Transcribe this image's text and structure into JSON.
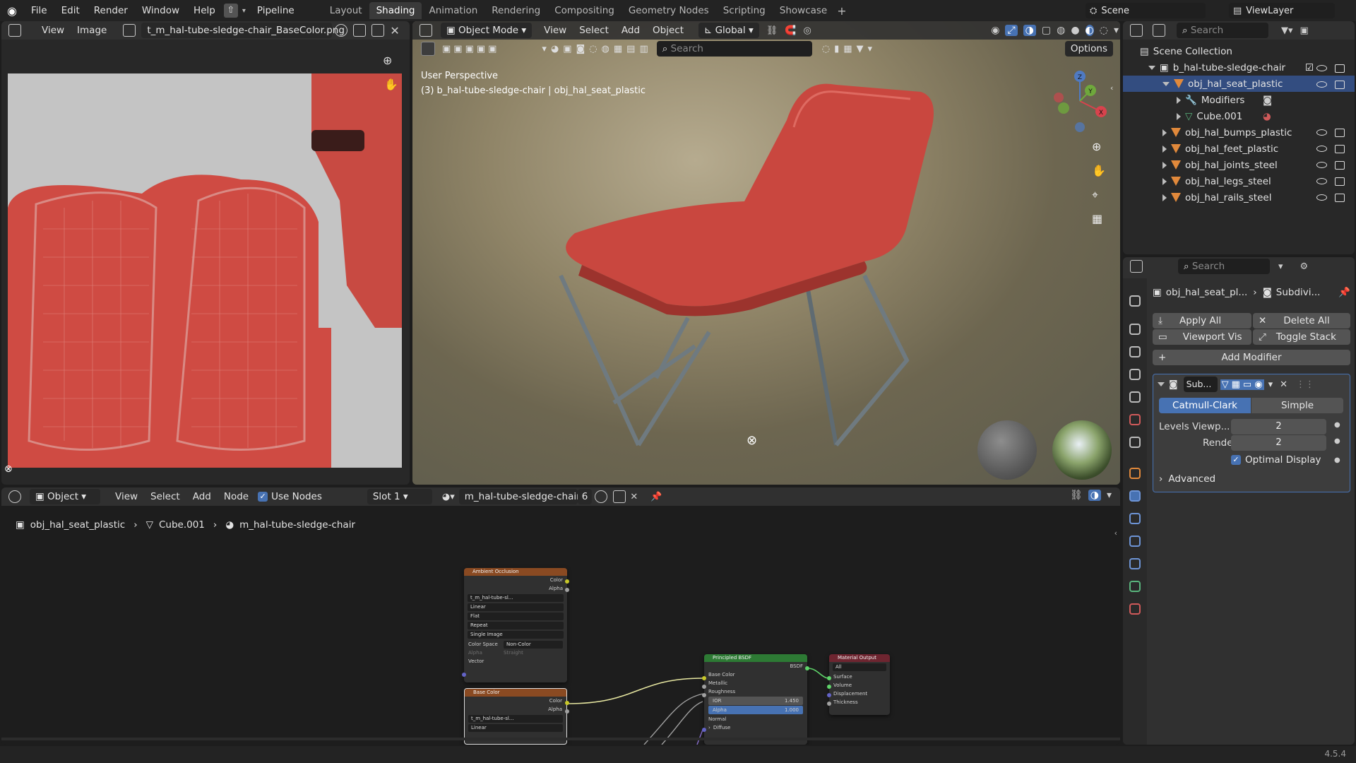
{
  "topbar": {
    "menus": [
      "File",
      "Edit",
      "Render",
      "Window",
      "Help"
    ],
    "pipeline": "Pipeline",
    "workspaces": [
      "Layout",
      "Shading",
      "Animation",
      "Rendering",
      "Compositing",
      "Geometry Nodes",
      "Scripting",
      "Showcase"
    ],
    "active_workspace": "Shading",
    "scene": "Scene",
    "view_layer": "ViewLayer"
  },
  "image_editor": {
    "menus": [
      "View",
      "Image"
    ],
    "image_name": "t_m_hal-tube-sledge-chair_BaseColor.png"
  },
  "viewport": {
    "mode": "Object Mode",
    "menus": [
      "View",
      "Select",
      "Add",
      "Object"
    ],
    "orientation": "Global",
    "search_placeholder": "Search",
    "options": "Options",
    "perspective_label": "User Perspective",
    "object_label": "(3) b_hal-tube-sledge-chair | obj_hal_seat_plastic",
    "axes": {
      "x": "X",
      "y": "Y",
      "z": "Z"
    }
  },
  "outliner": {
    "search_placeholder": "Search",
    "root": "Scene Collection",
    "collection": "b_hal-tube-sledge-chair",
    "active_object": "obj_hal_seat_plastic",
    "modifiers": "Modifiers",
    "mesh": "Cube.001",
    "objects": [
      "obj_hal_bumps_plastic",
      "obj_hal_feet_plastic",
      "obj_hal_joints_steel",
      "obj_hal_legs_steel",
      "obj_hal_rails_steel"
    ]
  },
  "properties": {
    "search_placeholder": "Search",
    "object_name": "obj_hal_seat_pl...",
    "modifier_crumb": "Subdivi...",
    "apply_all": "Apply All",
    "delete_all": "Delete All",
    "viewport_vis": "Viewport Vis",
    "toggle_stack": "Toggle Stack",
    "add_modifier": "Add Modifier",
    "modifier_name": "Sub...",
    "catmull": "Catmull-Clark",
    "simple": "Simple",
    "levels_label": "Levels Viewp...",
    "levels_value": "2",
    "render_label": "Render",
    "render_value": "2",
    "optimal_display": "Optimal Display",
    "advanced": "Advanced"
  },
  "node_editor": {
    "type": "Object",
    "menus": [
      "View",
      "Select",
      "Add",
      "Node"
    ],
    "use_nodes": "Use Nodes",
    "slot": "Slot 1",
    "material": "m_hal-tube-sledge-chair",
    "users": "6",
    "breadcrumb": [
      "obj_hal_seat_plastic",
      "Cube.001",
      "m_hal-tube-sledge-chair"
    ],
    "ao_node": {
      "title": "Ambient Occlusion",
      "outputs": [
        "Color",
        "Alpha"
      ],
      "image": "t_m_hal-tube-sl...",
      "dropdowns": [
        "Linear",
        "Flat",
        "Repeat",
        "Single Image"
      ],
      "color_space_label": "Color Space",
      "color_space": "Non-Color",
      "alpha_label": "Alpha",
      "alpha_value": "Straight",
      "vector": "Vector"
    },
    "base_node": {
      "title": "Base Color",
      "outputs": [
        "Color",
        "Alpha"
      ],
      "image": "t_m_hal-tube-sl...",
      "dropdown": "Linear"
    },
    "bsdf_node": {
      "title": "Principled BSDF",
      "output": "BSDF",
      "inputs": [
        "Base Color",
        "Metallic",
        "Roughness"
      ],
      "ior_label": "IOR",
      "ior_value": "1.450",
      "alpha_label": "Alpha",
      "alpha_value": "1.000",
      "normal": "Normal",
      "diffuse": "Diffuse"
    },
    "output_node": {
      "title": "Material Output",
      "target": "All",
      "inputs": [
        "Surface",
        "Volume",
        "Displacement",
        "Thickness"
      ]
    }
  },
  "status": {
    "version": "4.5.4"
  },
  "colors": {
    "accent": "#4772b3",
    "object_orange": "#e1893b",
    "seat_red": "#c8463e"
  }
}
